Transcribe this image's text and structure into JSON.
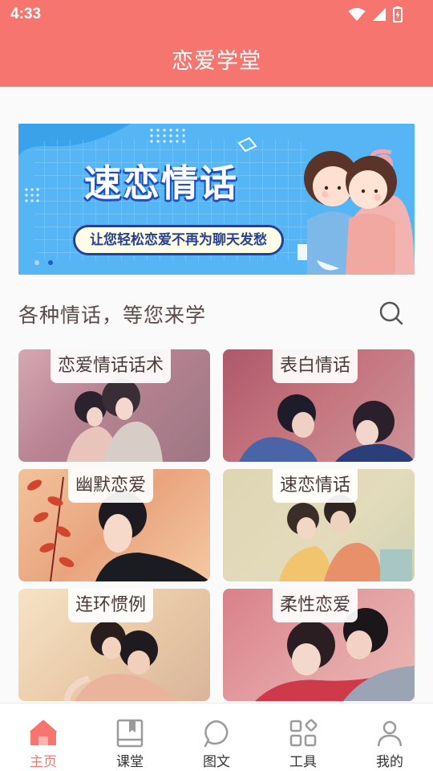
{
  "status_bar": {
    "time": "4:33"
  },
  "header": {
    "title": "恋爱学堂"
  },
  "banner": {
    "title": "速恋情话",
    "subtitle": "让您轻松恋爱不再为聊天发愁",
    "active_slide": 2,
    "slide_count": 2
  },
  "section": {
    "title": "各种情话，等您来学"
  },
  "cards": [
    {
      "label": "恋爱情话话术"
    },
    {
      "label": "表白情话"
    },
    {
      "label": "幽默恋爱"
    },
    {
      "label": "速恋情话"
    },
    {
      "label": "连环惯例"
    },
    {
      "label": "柔性恋爱"
    }
  ],
  "nav": {
    "items": [
      {
        "label": "主页",
        "icon": "home-icon",
        "active": true
      },
      {
        "label": "课堂",
        "icon": "book-icon",
        "active": false
      },
      {
        "label": "图文",
        "icon": "chat-bubble-icon",
        "active": false
      },
      {
        "label": "工具",
        "icon": "tools-grid-icon",
        "active": false
      },
      {
        "label": "我的",
        "icon": "person-icon",
        "active": false
      }
    ]
  },
  "colors": {
    "primary": "#f6766f",
    "nav_active": "#f6766f",
    "banner_bg": "#56b6f5"
  }
}
